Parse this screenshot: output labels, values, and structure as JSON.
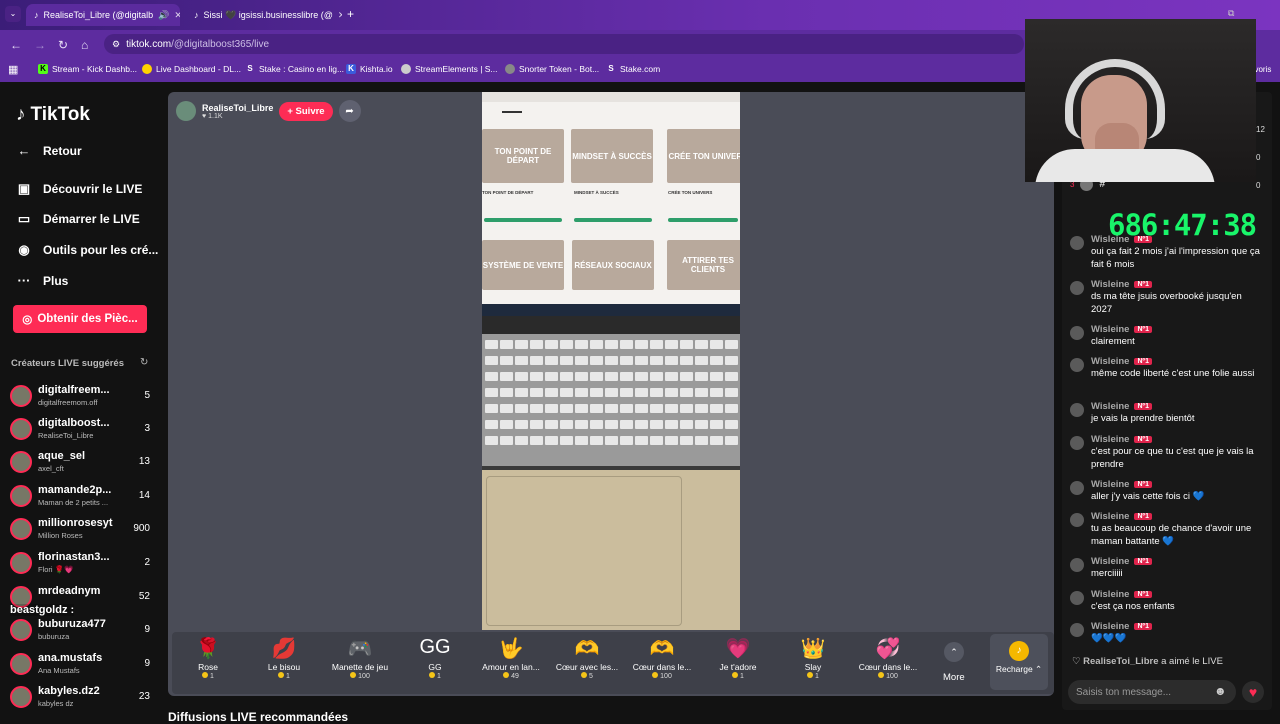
{
  "browser": {
    "tabs": [
      {
        "label": "RealiseToi_Libre (@digitalb"
      },
      {
        "label": "Sissi 🖤 igsissi.businesslibre (@"
      }
    ],
    "url_host": "tiktok.com",
    "url_path": "/@digitalboost365/live",
    "bookmarks": [
      "Stream - Kick Dashb...",
      "Live Dashboard - DL...",
      "Stake : Casino en lig...",
      "Kishta.io",
      "StreamElements | S...",
      "Snorter Token - Bot...",
      "Stake.com"
    ],
    "overflow": "ovoris"
  },
  "sidebar": {
    "logo": "TikTok",
    "nav": [
      "Retour",
      "Découvrir le LIVE",
      "Démarrer le LIVE",
      "Outils pour les cré...",
      "Plus"
    ],
    "coins_button": "Obtenir des Pièc...",
    "suggested_title": "Créateurs LIVE suggérés",
    "creators": [
      {
        "name": "digitalfreem...",
        "sub": "digitalfreemom.off",
        "count": "5"
      },
      {
        "name": "digitalboost...",
        "sub": "RealiseToi_Libre",
        "count": "3"
      },
      {
        "name": "aque_sel",
        "sub": "axel_cft",
        "count": "13"
      },
      {
        "name": "mamande2p...",
        "sub": "Maman de 2 petits ...",
        "count": "14"
      },
      {
        "name": "millionrosesyt",
        "sub": "Million Roses",
        "count": "900"
      },
      {
        "name": "florinastan3...",
        "sub": "Flori 🌹💗",
        "count": "2"
      },
      {
        "name": "mrdeadnym",
        "sub": "",
        "count": "52"
      },
      {
        "name": "buburuza477",
        "sub": "buburuza",
        "count": "9"
      },
      {
        "name": "ana.mustafs",
        "sub": "Ana Mustafs",
        "count": "9"
      },
      {
        "name": "kabyles.dz2",
        "sub": "kabyles dz",
        "count": "23"
      }
    ],
    "overlay_text": "beastgoldz :"
  },
  "host": {
    "name": "RealiseToi_Libre",
    "likes": "1.1K",
    "follow": "+ Suivre"
  },
  "video": {
    "cards": [
      "TON POINT DE DÉPART",
      "MINDSET À SUCCÈS",
      "CRÉE TON UNIVERS",
      "SYSTÈME DE VENTE",
      "RÉSEAUX SOCIAUX",
      "ATTIRER TES CLIENTS"
    ]
  },
  "gifts": [
    {
      "name": "Rose",
      "price": "1",
      "icon": "🌹"
    },
    {
      "name": "Le bisou",
      "price": "1",
      "icon": "💋"
    },
    {
      "name": "Manette de jeu",
      "price": "100",
      "icon": "🎮"
    },
    {
      "name": "GG",
      "price": "1",
      "icon": "GG"
    },
    {
      "name": "Amour en lan...",
      "price": "49",
      "icon": "🤟"
    },
    {
      "name": "Cœur avec les...",
      "price": "5",
      "icon": "🫶"
    },
    {
      "name": "Cœur dans le...",
      "price": "100",
      "icon": "🫶"
    },
    {
      "name": "Je t'adore",
      "price": "1",
      "icon": "💗"
    },
    {
      "name": "Slay",
      "price": "1",
      "icon": "👑"
    },
    {
      "name": "Cœur dans le...",
      "price": "100",
      "icon": "💞"
    }
  ],
  "more_label": "More",
  "recharge_label": "Recharge ⌃",
  "recommended_heading": "Diffusions LIVE recommandées",
  "chat": {
    "viewer_counts": [
      "12",
      "0",
      "0"
    ],
    "rank_num": "3",
    "hash": "#",
    "timer": "686:47:38",
    "badge": "Nº1",
    "messages": [
      {
        "user": "Wisleine",
        "text": "oui ça fait 2 mois j'ai l'impression que ça fait 6 mois"
      },
      {
        "user": "Wisleine",
        "text": "ds ma tête jsuis overbooké jusqu'en 2027"
      },
      {
        "user": "Wisleine",
        "text": "clairement"
      },
      {
        "user": "Wisleine",
        "text": "même code liberté c'est une folie aussi"
      },
      {
        "user": "Wisleine",
        "text": "je vais la prendre bientôt"
      },
      {
        "user": "Wisleine",
        "text": "c'est pour ce que tu c'est que je vais la prendre"
      },
      {
        "user": "Wisleine",
        "text": "aller j'y vais cette fois ci 💙"
      },
      {
        "user": "Wisleine",
        "text": "tu as beaucoup de chance d'avoir une maman battante 💙"
      },
      {
        "user": "Wisleine",
        "text": "merciiiii"
      },
      {
        "user": "Wisleine",
        "text": "c'est ça nos enfants"
      },
      {
        "user": "Wisleine",
        "text": "💙💙💙"
      }
    ],
    "liked_user": "RealiseToi_Libre",
    "liked_text": "a aimé le LIVE",
    "input_placeholder": "Saisis ton message..."
  }
}
